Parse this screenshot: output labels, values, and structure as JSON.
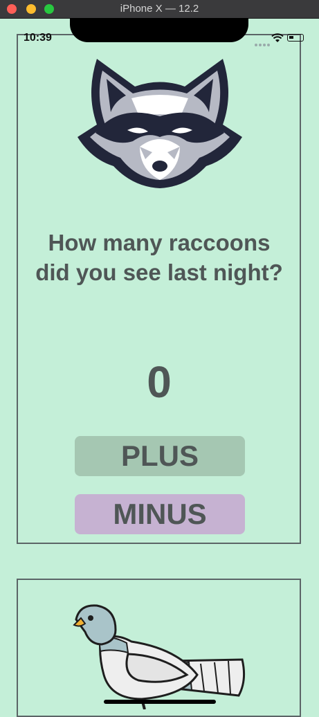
{
  "window": {
    "title": "iPhone X — 12.2"
  },
  "status_bar": {
    "time": "10:39",
    "icons": [
      "signal-dots-icon",
      "wifi-icon",
      "battery-icon"
    ]
  },
  "counter_card": {
    "logo": "raccoon-icon",
    "question": "How many raccoons did you see last night?",
    "count": "0",
    "plus_label": "PLUS",
    "minus_label": "MINUS"
  },
  "second_card": {
    "image": "pigeon-icon"
  },
  "colors": {
    "background": "#c4efd8",
    "text": "#4f5656",
    "plus_button": "#a5c7b2",
    "minus_button": "#c6b2d2"
  }
}
